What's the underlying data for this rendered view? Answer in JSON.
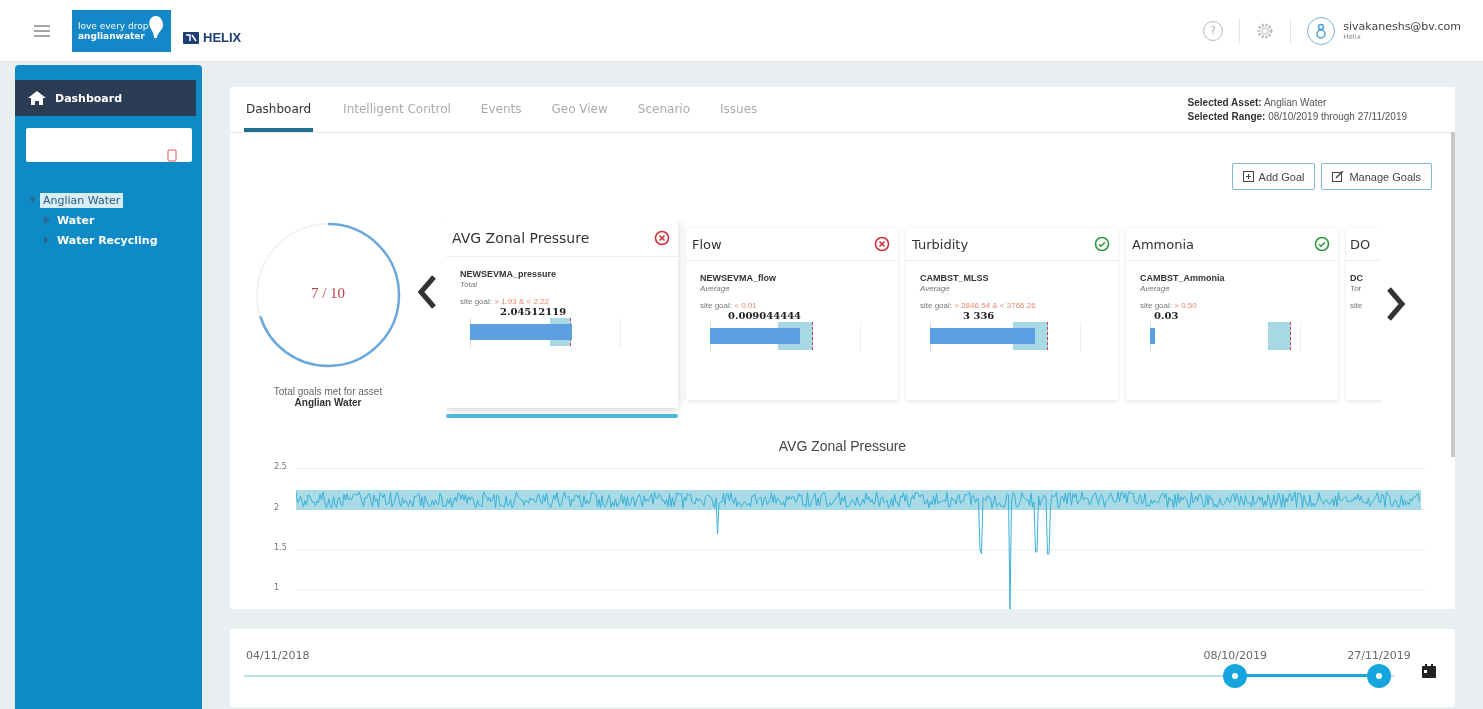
{
  "header": {
    "logo_line1": "love every drop",
    "logo_line2": "anglianwater",
    "product": "HELIX",
    "help": "?",
    "user": {
      "email": "sivakaneshs@bv.com",
      "subtitle": "Helix"
    }
  },
  "sidebar": {
    "title": "Dashboard",
    "tree": [
      {
        "label": "Anglian Water",
        "expanded": true,
        "selected": true,
        "children": [
          {
            "label": "Water",
            "expanded": false,
            "selected": false
          },
          {
            "label": "Water Recycling",
            "expanded": false,
            "selected": false
          }
        ]
      }
    ]
  },
  "tabs": [
    {
      "label": "Dashboard",
      "selected": true
    },
    {
      "label": "Intelligent Control",
      "selected": false
    },
    {
      "label": "Events",
      "selected": false
    },
    {
      "label": "Geo View",
      "selected": false
    },
    {
      "label": "Scenario",
      "selected": false
    },
    {
      "label": "Issues",
      "selected": false
    }
  ],
  "selection": {
    "asset_label": "Selected Asset:",
    "asset": "Anglian Water",
    "range_label": "Selected Range:",
    "range": "08/10/2019 through 27/11/2019"
  },
  "buttons": [
    {
      "label": "Add Goal",
      "kind": "add"
    },
    {
      "label": "Manage Goals",
      "kind": "edit"
    }
  ],
  "summary": {
    "score": "7 / 10",
    "caption": "Total goals met for asset",
    "asset": "Anglian Water"
  },
  "goal_cards": [
    {
      "kind": "metric",
      "title": "AVG Zonal Pressure",
      "met": false,
      "selected": true,
      "sensor": "NEWSEVMA_pressure",
      "aggregation": "Total",
      "goal_label": "site goal:",
      "goal": "> 1.93 & < 2.22",
      "value": "2.04512119"
    },
    {
      "kind": "metric",
      "title": "Flow",
      "met": false,
      "selected": false,
      "sensor": "NEWSEVMA_flow",
      "aggregation": "Average",
      "goal_label": "site goal:",
      "goal": "< 0.01",
      "value": "0.009044444"
    },
    {
      "kind": "metric",
      "title": "Turbidity",
      "met": true,
      "selected": false,
      "sensor": "CAMBST_MLSS",
      "aggregation": "Average",
      "goal_label": "site goal:",
      "goal": "> 2846.54 & < 3766.26",
      "value": "3 336"
    },
    {
      "kind": "metric",
      "title": "Ammonia",
      "met": true,
      "selected": false,
      "sensor": "CAMBST_Ammonia",
      "aggregation": "Average",
      "goal_label": "site goal:",
      "goal": "> 0.50",
      "value": "0.03"
    },
    {
      "kind": "partial",
      "title": "DO",
      "selected": false,
      "sensor": "DC",
      "aggregation": "Tot",
      "goal_label": "site"
    }
  ],
  "chart": {
    "title": "AVG Zonal Pressure",
    "y_tick_labels": [
      "2.5",
      "2",
      "1.5",
      "1"
    ]
  },
  "timeline": {
    "start": "04/11/2018",
    "from": {
      "label": "08/10/2019"
    },
    "to": {
      "label": "27/11/2019"
    }
  }
}
